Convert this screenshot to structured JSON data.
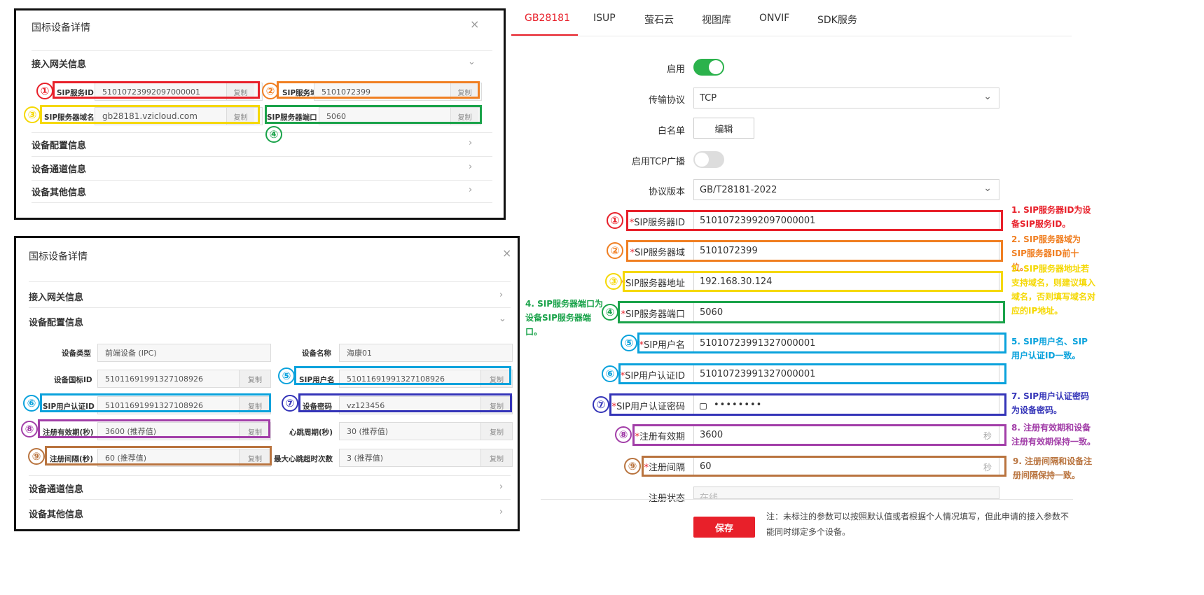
{
  "panel1": {
    "title": "国标设备详情",
    "close": "×",
    "section1": "接入网关信息",
    "fields": [
      {
        "label": "SIP服务ID",
        "value": "51010723992097000001",
        "copy": "复制"
      },
      {
        "label": "SIP服务域",
        "value": "5101072399",
        "copy": "复制"
      },
      {
        "label": "SIP服务器域名",
        "value": "gb28181.vzicloud.com",
        "copy": "复制"
      },
      {
        "label": "SIP服务器端口",
        "value": "5060",
        "copy": "复制"
      }
    ],
    "section2": "设备配置信息",
    "section3": "设备通道信息",
    "section4": "设备其他信息"
  },
  "panel2": {
    "title": "国标设备详情",
    "close": "×",
    "section1": "接入网关信息",
    "section2": "设备配置信息",
    "rows": [
      {
        "label": "设备类型",
        "value": "前端设备 (IPC)"
      },
      {
        "label": "设备名称",
        "value": "海康01"
      },
      {
        "label": "设备国标ID",
        "value": "51011691991327108926",
        "copy": "复制"
      },
      {
        "label": "SIP用户名",
        "value": "51011691991327108926",
        "copy": "复制"
      },
      {
        "label": "SIP用户认证ID",
        "value": "51011691991327108926",
        "copy": "复制"
      },
      {
        "label": "设备密码",
        "value": "vz123456",
        "copy": "复制"
      },
      {
        "label": "注册有效期(秒)",
        "value": "3600 (推荐值)",
        "copy": "复制"
      },
      {
        "label": "心跳周期(秒)",
        "value": "30 (推荐值)",
        "copy": "复制"
      },
      {
        "label": "注册间隔(秒)",
        "value": "60 (推荐值)",
        "copy": "复制"
      },
      {
        "label": "最大心跳超时次数",
        "value": "3 (推荐值)",
        "copy": "复制"
      }
    ],
    "section3": "设备通道信息",
    "section4": "设备其他信息"
  },
  "tabs": [
    "GB28181",
    "ISUP",
    "萤石云",
    "视图库",
    "ONVIF",
    "SDK服务"
  ],
  "form": {
    "enable_label": "启用",
    "protocol_label": "传输协议",
    "protocol_value": "TCP",
    "whitelist_label": "白名单",
    "whitelist_button": "编辑",
    "tcp_broadcast_label": "启用TCP广播",
    "version_label": "协议版本",
    "version_value": "GB/T28181-2022",
    "fields": [
      {
        "label": "SIP服务器ID",
        "value": "51010723992097000001"
      },
      {
        "label": "SIP服务器域",
        "value": "5101072399"
      },
      {
        "label": "SIP服务器地址",
        "value": "192.168.30.124"
      },
      {
        "label": "SIP服务器端口",
        "value": "5060"
      },
      {
        "label": "SIP用户名",
        "value": "51010723991327000001"
      },
      {
        "label": "SIP用户认证ID",
        "value": "51010723991327000001"
      },
      {
        "label": "SIP用户认证密码",
        "value": "••••••••"
      },
      {
        "label": "注册有效期",
        "value": "3600",
        "unit": "秒"
      },
      {
        "label": "注册间隔",
        "value": "60",
        "unit": "秒"
      }
    ],
    "status_label": "注册状态",
    "status_value": "在线",
    "save_button": "保存",
    "note": "注：未标注的参数可以按照默认值或者根据个人情况填写，但此申请的接入参数不能同时绑定多个设备。"
  },
  "numbers": [
    "①",
    "②",
    "③",
    "④",
    "⑤",
    "⑥",
    "⑦",
    "⑧",
    "⑨"
  ],
  "annotations": [
    "1. SIP服务器ID为设备SIP服务ID。",
    "2. SIP服务器域为SIP服务器ID前十位。",
    "3. SIP服务器地址若支持域名，则建议填入域名，否则填写域名对应的IP地址。",
    "4. SIP服务器端口为设备SIP服务器端口。",
    "5. SIP用户名、SIP用户认证ID一致。",
    "7. SIP用户认证密码为设备密码。",
    "8. 注册有效期和设备注册有效期保持一致。",
    "9. 注册间隔和设备注册间隔保持一致。"
  ],
  "colors": {
    "c1": "#e8202a",
    "c2": "#f07f22",
    "c3": "#f5d800",
    "c4": "#1aa34a",
    "c5": "#0aa2dc",
    "c7": "#3434b8",
    "c8": "#a23ea8",
    "c9": "#b9743f",
    "accent": "#e8202a",
    "switch_on": "#2bb24c"
  }
}
